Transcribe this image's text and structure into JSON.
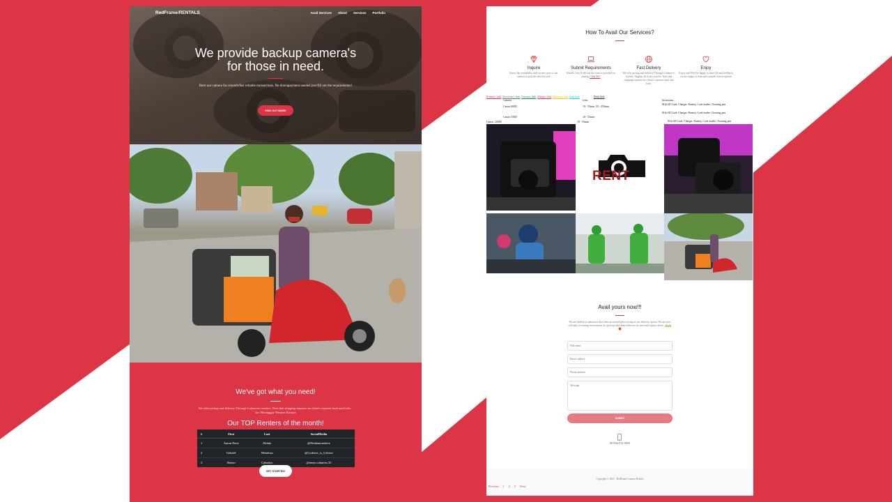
{
  "colors": {
    "accent": "#dc3545",
    "dark": "#212529",
    "white": "#ffffff"
  },
  "left": {
    "brand": "RedFrame/RENTALS",
    "nav": [
      "Avail Services",
      "About",
      "Services",
      "Portfolio"
    ],
    "masthead": {
      "title_line1": "We provide backup camera's",
      "title_line2": "for those in need.",
      "text": "Rent our camera for smooth/fast reliable transactions. No downpayment needed just fill out the requirements!",
      "button": "FIND OUT MORE"
    },
    "section": {
      "title": "We've got what you need!",
      "text": "We offer pickup and delivery Through Lalamove couriers. Note that shipping expense are client's expense back and forth. · loc: Baranggay Western Bicutan"
    },
    "renters": {
      "title": "Our TOP Renters of the month!",
      "headers": [
        "#",
        "First",
        "Last",
        "SocialMedia"
      ],
      "rows": [
        [
          "1",
          "Aaron Dave",
          "Deinla",
          "@Deinlaarondave"
        ],
        [
          "2",
          "Gabriel",
          "Mendoza",
          "@Codeeee_is_Lifeeee"
        ],
        [
          "3",
          "Renzo",
          "Cabarios",
          "@renzo.cabarios.33"
        ]
      ]
    },
    "cta": "GET STARTED!"
  },
  "right": {
    "how_title": "How To Avail Our Services?",
    "services": [
      {
        "icon": "gem-icon",
        "title": "Inquire",
        "desc": "Know the availability and current rates of our camera to pick the best for you!"
      },
      {
        "icon": "laptop-icon",
        "title": "Submit Requirements",
        "desc": "Kindly view & fill out the form to proceed on renting",
        "link": "Click Me!"
      },
      {
        "icon": "globe-icon",
        "title": "Fast Delivery",
        "desc": "We offer pickup and delivery Through Lalamove, Joyride, Angkas, & Grab couriers. Note that shipping expense are client's expense back and forth."
      },
      {
        "icon": "heart-icon",
        "title": "Enjoy",
        "desc": "Enjoy and We'd be happy to hear QA and feedback we are happy to hear and consider every opinion"
      }
    ],
    "links": [
      "Primary link",
      "Secondary link",
      "Success link",
      "Danger link",
      "Warning link",
      "Info link",
      "Dark link"
    ],
    "link_colors": [
      "#dc3545",
      "#6c757d",
      "#198754",
      "#dc3545",
      "#ffc107",
      "#0dcaf0",
      "#212529"
    ],
    "cameras": {
      "camera_label": "Camera",
      "camera1": "Canon 600D",
      "camera2": "Canon 550D",
      "camera3": "Canon 1200D",
      "lens_label": "Lens",
      "lens1": "18 - 55mm, 55 - 250mm",
      "lens2": "18 - 55mm",
      "lens3": "18 - 55mm",
      "inclusions_label": "Inclusions:",
      "inclusion1": "8Gb SD Card, Charger, Battery, Card reader, Cleaning pen",
      "inclusion2": "8Gb SD Card, Charger, Battery, Card reader, Cleaning pen",
      "inclusion3": "8Gb SD Card, Charger, Battery, Card reader, Cleaning pen"
    },
    "rent_logo_text": "RENT",
    "avail": {
      "title": "Avail yours now!!!",
      "text": "We are thrilled to announce that after successful pilot testing of our delivery option. We are now officially accepting reservations for pick-up and return delivery for new and repeat clients. 🛵🛵🎁",
      "fullname": "Full name",
      "email": "Email address",
      "phone": "Phone number",
      "message": "Message",
      "submit": "SUBMIT",
      "contact_phone": "09-956-974-9035"
    },
    "footer": {
      "copyright": "Copyright © 2021 - RedFrame Camera Rentals",
      "prev": "Previous",
      "pages": [
        "1",
        "2",
        "3"
      ],
      "next": "Next"
    }
  }
}
